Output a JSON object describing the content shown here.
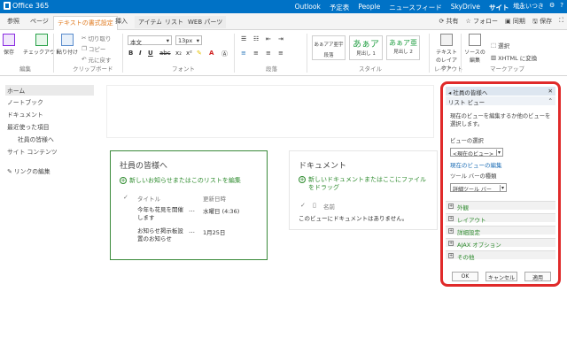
{
  "suite": {
    "app_name": "Office 365",
    "nav": [
      "Outlook",
      "予定表",
      "People",
      "ニュースフィード",
      "SkyDrive",
      "サイト",
      "…"
    ],
    "user": "増永いつき",
    "settings": "⚙",
    "help": "?"
  },
  "ribbon_tabs": {
    "browse": "参照",
    "page": "ページ",
    "format_text": "テキストの書式設定",
    "insert": "挿入",
    "items": "アイテム",
    "list": "リスト",
    "web_parts": "WEB パーツ"
  },
  "ribbon_actions": {
    "share": "共有",
    "follow": "フォロー",
    "sync": "同期",
    "save": "保存"
  },
  "ribbon": {
    "edit_group": "編集",
    "save": "保存",
    "checkout": "チェックアウト",
    "clipboard_group": "クリップボード",
    "paste": "貼り付け",
    "cut": "切り取り",
    "copy": "コピー",
    "undo": "元に戻す",
    "font_group": "フォント",
    "font_name": "本文",
    "font_size": "13px",
    "paragraph_group": "段落",
    "styles_group": "スタイル",
    "style1_big": "あぁアア亜宇",
    "style1_label": "段落",
    "style2_big": "あぁア",
    "style2_label": "見出し 1",
    "style3_big": "あぁア亜",
    "style3_label": "見出し 2",
    "layout_group": "レイアウト",
    "text_layout": "テキストのレイアウト",
    "markup_group": "マークアップ",
    "source_edit": "ソースの編集",
    "select": "選択",
    "xhtml": "XHTML に変換"
  },
  "leftnav": {
    "items": [
      "ホーム",
      "ノートブック",
      "ドキュメント",
      "最近使った項目",
      "社員の皆様へ",
      "サイト コンテンツ"
    ],
    "edit_links": "リンクの編集"
  },
  "webpart1": {
    "title": "社員の皆様へ",
    "add_link": "新しいお知らせまたはこのリストを編集",
    "col_title": "タイトル",
    "col_modified": "更新日時",
    "rows": [
      {
        "title": "今年も花見を開催します",
        "more": "…",
        "date": "水曜日 (4:36)"
      },
      {
        "title": "お知らせ掲示板設置のお知らせ",
        "more": "…",
        "date": "1月25日"
      }
    ]
  },
  "webpart2": {
    "title": "ドキュメント",
    "add_link": "新しいドキュメントまたはここにファイルをドラッグ",
    "col_name": "名前",
    "empty": "このビューにドキュメントはありません。"
  },
  "toolpane": {
    "title": "社員の皆様へ",
    "list_view": "リスト ビュー",
    "desc": "現在のビューを編集するか他のビューを選択します。",
    "view_select_label": "ビューの選択",
    "view_select_value": "<現在のビュー>",
    "edit_current_view": "現在のビューの編集",
    "toolbar_type_label": "ツール バーの種類",
    "toolbar_type_value": "詳細ツール バー",
    "sections": [
      "外観",
      "レイアウト",
      "詳細設定",
      "AJAX オプション",
      "その他"
    ],
    "ok": "OK",
    "cancel": "キャンセル",
    "apply": "適用"
  },
  "colors": {
    "suite_blue": "#0072c6",
    "accent_orange": "#e07a1f",
    "green": "#2e8b2e",
    "highlight_red": "#e02a2a"
  }
}
